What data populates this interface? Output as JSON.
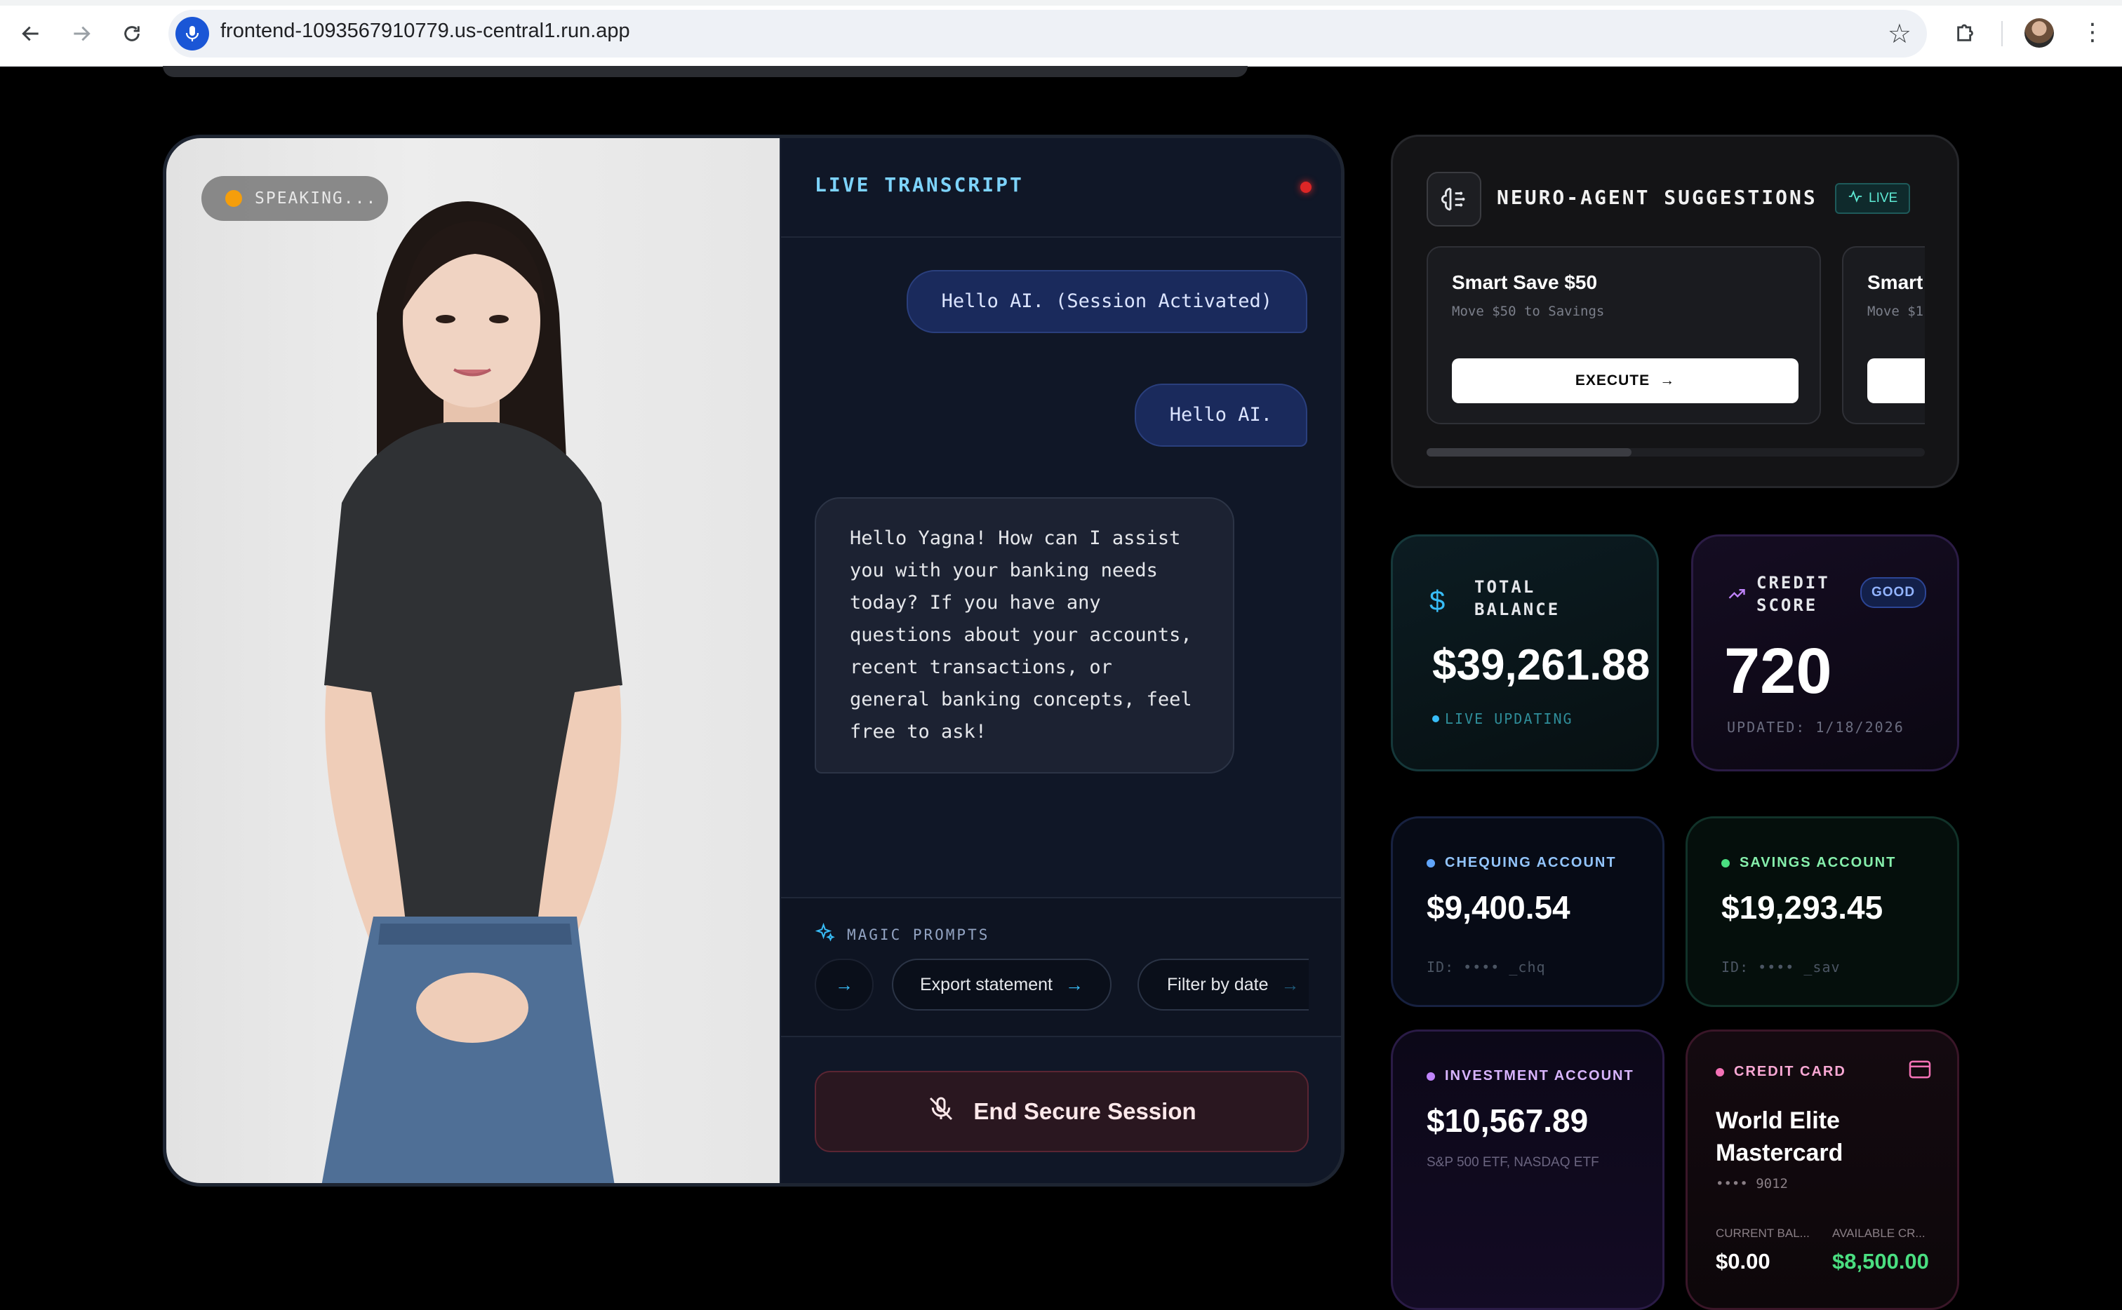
{
  "browser": {
    "url": "frontend-1093567910779.us-central1.run.app"
  },
  "video": {
    "status_label": "SPEAKING..."
  },
  "transcript": {
    "title": "LIVE TRANSCRIPT",
    "messages": [
      {
        "role": "user",
        "text": "Hello AI. (Session Activated)"
      },
      {
        "role": "user",
        "text": "Hello AI."
      },
      {
        "role": "ai",
        "text": "Hello Yagna! How can I assist you with your banking needs today? If you have any questions about your accounts, recent transactions, or general banking concepts, feel free to ask!"
      }
    ],
    "magic_prompts_label": "MAGIC PROMPTS",
    "prompts": [
      "Export statement",
      "Filter by date"
    ],
    "end_session_label": "End Secure Session"
  },
  "suggestions": {
    "title": "NEURO-AGENT SUGGESTIONS",
    "live_badge": "LIVE",
    "items": [
      {
        "title": "Smart Save $50",
        "subtitle": "Move $50 to Savings",
        "action": "EXECUTE"
      },
      {
        "title": "Smart",
        "subtitle": "Move $1",
        "action": ""
      }
    ]
  },
  "balance": {
    "label_line1": "TOTAL",
    "label_line2": "BALANCE",
    "value": "$39,261.88",
    "status": "LIVE UPDATING"
  },
  "credit_score": {
    "label_line1": "CREDIT",
    "label_line2": "SCORE",
    "badge": "GOOD",
    "value": "720",
    "updated": "UPDATED: 1/18/2026"
  },
  "accounts": {
    "chequing": {
      "label": "CHEQUING ACCOUNT",
      "amount": "$9,400.54",
      "id": "ID: •••• _chq"
    },
    "savings": {
      "label": "SAVINGS ACCOUNT",
      "amount": "$19,293.45",
      "id": "ID: •••• _sav"
    },
    "investment": {
      "label": "INVESTMENT ACCOUNT",
      "amount": "$10,567.89",
      "detail": "S&P 500 ETF, NASDAQ ETF"
    }
  },
  "credit_card": {
    "label": "CREDIT CARD",
    "name_line1": "World Elite",
    "name_line2": "Mastercard",
    "number": "•••• 9012",
    "current_label": "CURRENT BAL...",
    "current_value": "$0.00",
    "available_label": "AVAILABLE CR...",
    "available_value": "$8,500.00"
  },
  "colors": {
    "accent_cyan": "#38bdf8",
    "accent_green": "#4ade80",
    "accent_purple": "#c084fc",
    "accent_pink": "#f472b6",
    "danger": "#dc2626"
  }
}
